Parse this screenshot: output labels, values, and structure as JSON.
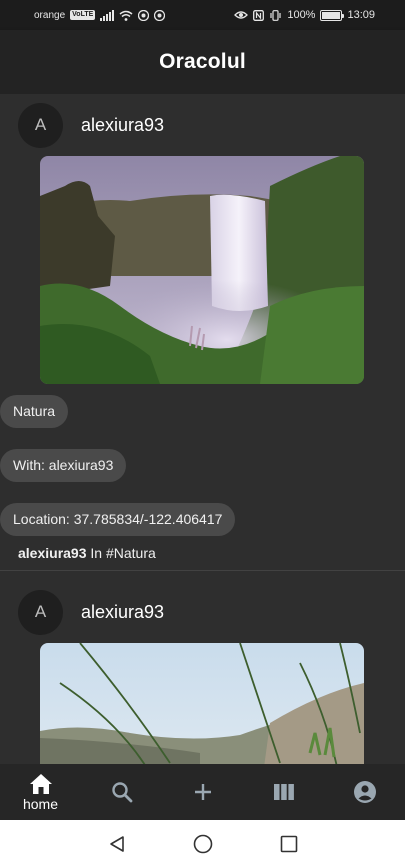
{
  "status_bar": {
    "carrier": "orange",
    "volte": "VoLTE",
    "battery_text": "100%",
    "battery_level": 1.0,
    "time": "13:09"
  },
  "app_bar": {
    "title": "Oracolul"
  },
  "posts": [
    {
      "avatar_letter": "A",
      "username": "alexiura93",
      "image_icon": "waterfall-photo",
      "chips": {
        "category": "Natura",
        "with": "With: alexiura93",
        "location": "Location: 37.785834/-122.406417"
      },
      "caption_user": "alexiura93",
      "caption_rest": " In #Natura"
    },
    {
      "avatar_letter": "A",
      "username": "alexiura93",
      "image_icon": "dune-grass-photo"
    }
  ],
  "bottom_nav": {
    "items": [
      {
        "icon": "home-icon",
        "label": "home",
        "active": true
      },
      {
        "icon": "search-icon",
        "active": false
      },
      {
        "icon": "plus-icon",
        "active": false
      },
      {
        "icon": "library-icon",
        "active": false
      },
      {
        "icon": "account-circle-icon",
        "active": false
      }
    ]
  },
  "colors": {
    "background": "#2e2e2e",
    "app_bar": "#232323",
    "chip": "#4a4a4a",
    "nav_inactive": "#9aa7b1"
  }
}
